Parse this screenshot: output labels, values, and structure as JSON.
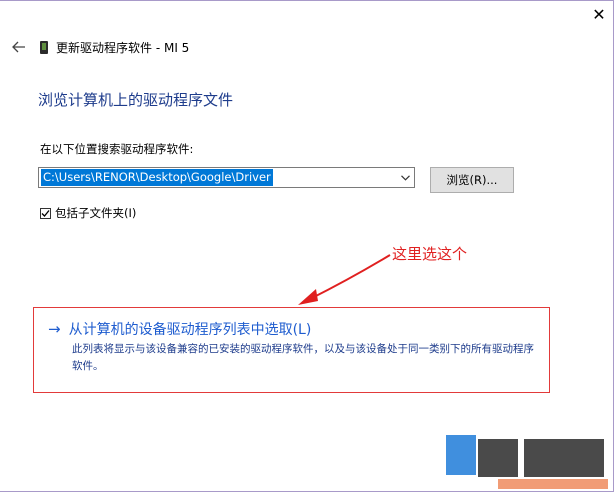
{
  "titlebar": {
    "close_glyph": "✕"
  },
  "header": {
    "title": "更新驱动程序软件 - MI 5"
  },
  "main": {
    "page_title": "浏览计算机上的驱动程序文件",
    "search_label": "在以下位置搜索驱动程序软件:",
    "path_value": "C:\\Users\\RENOR\\Desktop\\Google\\Driver",
    "browse_label": "浏览(R)...",
    "include_subfolders_label": "包括子文件夹(I)",
    "include_subfolders_checked": true,
    "option_title": "从计算机的设备驱动程序列表中选取(L)",
    "option_desc": "此列表将显示与该设备兼容的已安装的驱动程序软件，以及与该设备处于同一类别下的所有驱动程序软件。"
  },
  "annotation": {
    "text": "这里选这个",
    "color": "#e02020"
  },
  "colors": {
    "title_blue": "#1e3c8c",
    "link_blue": "#1e5ccf",
    "selection_blue": "#0078d7",
    "highlight_red": "#e23a3a"
  }
}
